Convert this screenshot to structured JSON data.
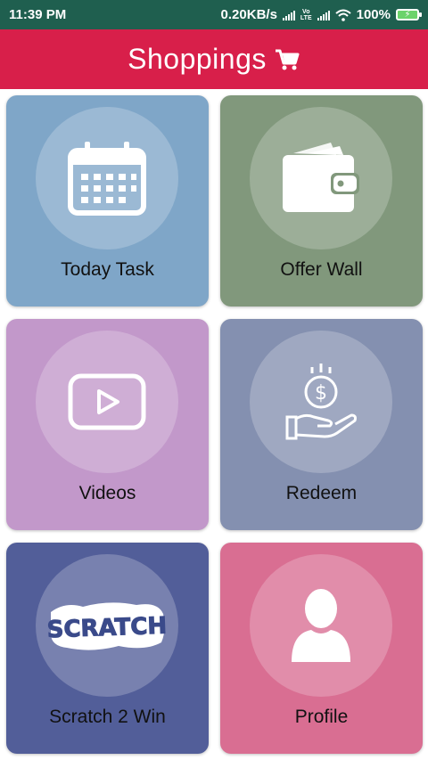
{
  "status_bar": {
    "time": "11:39 PM",
    "network_speed": "0.20KB/s",
    "lte_label": "Vo LTE",
    "battery": "100%"
  },
  "app_bar": {
    "title": "Shoppings",
    "icon": "cart-icon"
  },
  "tiles": [
    {
      "label": "Today Task",
      "icon": "calendar-icon",
      "color": "#7fa6c8"
    },
    {
      "label": "Offer Wall",
      "icon": "wallet-icon",
      "color": "#81987c"
    },
    {
      "label": "Videos",
      "icon": "play-video-icon",
      "color": "#c298ca"
    },
    {
      "label": "Redeem",
      "icon": "coin-hand-icon",
      "color": "#8490b0"
    },
    {
      "label": "Scratch 2 Win",
      "icon": "scratch-logo",
      "logo_text": "SCRATCH",
      "color": "#525e99"
    },
    {
      "label": "Profile",
      "icon": "user-icon",
      "color": "#d96e92"
    }
  ],
  "colors": {
    "status_bar": "#1f5f4f",
    "app_bar": "#d81f4a"
  }
}
